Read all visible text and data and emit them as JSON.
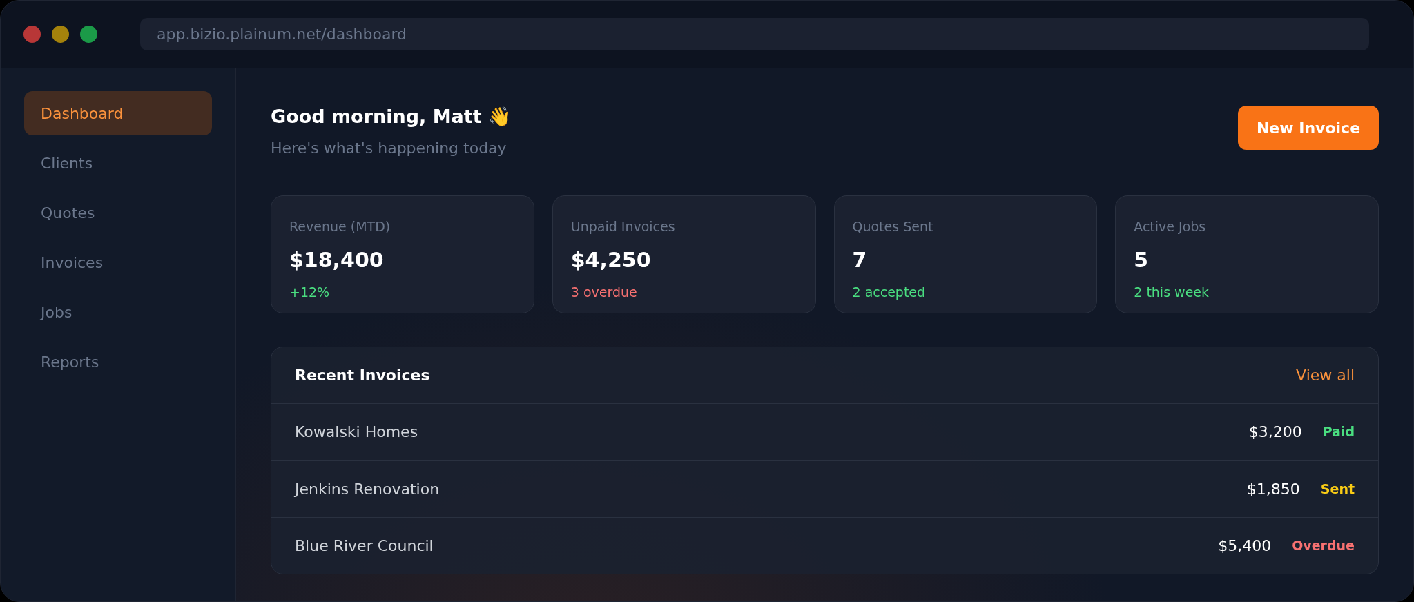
{
  "window": {
    "url": "app.bizio.plainum.net/dashboard"
  },
  "sidebar": {
    "items": [
      {
        "label": "Dashboard",
        "selected": true
      },
      {
        "label": "Clients",
        "selected": false
      },
      {
        "label": "Quotes",
        "selected": false
      },
      {
        "label": "Invoices",
        "selected": false
      },
      {
        "label": "Jobs",
        "selected": false
      },
      {
        "label": "Reports",
        "selected": false
      }
    ]
  },
  "header": {
    "greeting": "Good morning, Matt 👋",
    "subtitle": "Here's what's happening today",
    "button": "New Invoice"
  },
  "stats": [
    {
      "label": "Revenue (MTD)",
      "value": "$18,400",
      "note": "+12%",
      "color": "#4ade80"
    },
    {
      "label": "Unpaid Invoices",
      "value": "$4,250",
      "note": "3 overdue",
      "color": "#f87171"
    },
    {
      "label": "Quotes Sent",
      "value": "7",
      "note": "2 accepted",
      "color": "#4ade80"
    },
    {
      "label": "Active Jobs",
      "value": "5",
      "note": "2 this week",
      "color": "#4ade80"
    }
  ],
  "recent_invoices": {
    "title": "Recent Invoices",
    "link": "View all",
    "rows": [
      {
        "client": "Kowalski Homes",
        "amount": "$3,200",
        "status": "Paid",
        "color": "#4ade80"
      },
      {
        "client": "Jenkins Renovation",
        "amount": "$1,850",
        "status": "Sent",
        "color": "#facc15"
      },
      {
        "client": "Blue River Council",
        "amount": "$5,400",
        "status": "Overdue",
        "color": "#f87171"
      }
    ]
  }
}
